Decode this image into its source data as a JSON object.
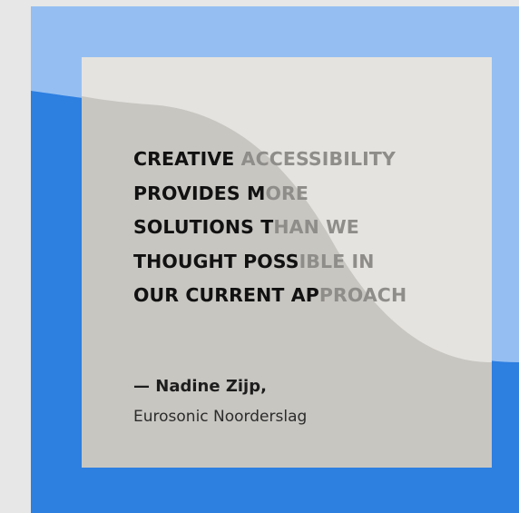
{
  "quote": {
    "lines": [
      {
        "strong": "CREATIVE ",
        "light": "ACCESSIBILITY"
      },
      {
        "strong": "PROVIDES M",
        "light": "ORE"
      },
      {
        "strong": "SOLUTIONS T",
        "light": "HAN WE"
      },
      {
        "strong": "THOUGHT POSS",
        "light": "IBLE IN"
      },
      {
        "strong": "OUR CURRENT AP",
        "light": "PROACH"
      }
    ]
  },
  "attribution": {
    "author": "— Nadine Zijp,",
    "organization": "Eurosonic Noorderslag"
  },
  "colors": {
    "page_bg": "#e6e7e6",
    "blue": "#2d7fe0",
    "light_blue": "#95bff2",
    "card_light": "#e5e3df",
    "card_dark": "#c8c6c1",
    "text_dark": "#111111",
    "text_faded": "#8f8d8a"
  }
}
